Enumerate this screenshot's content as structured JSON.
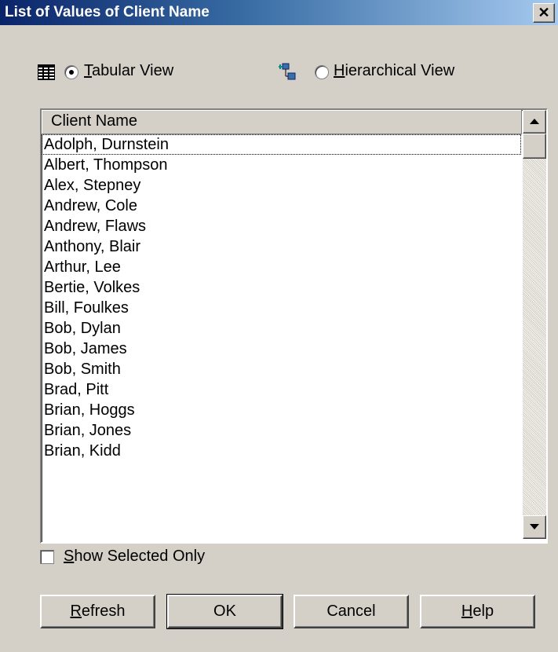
{
  "window": {
    "title": "List of Values of Client Name",
    "close_label": "✕"
  },
  "view": {
    "tabular": {
      "mnemonic": "T",
      "rest": "abular View",
      "selected": true
    },
    "hierarchical": {
      "mnemonic": "H",
      "rest": "ierarchical View",
      "selected": false
    }
  },
  "list": {
    "column_header": "Client Name",
    "rows": [
      "Adolph, Durnstein",
      "Albert, Thompson",
      "Alex, Stepney",
      "Andrew, Cole",
      "Andrew, Flaws",
      "Anthony, Blair",
      "Arthur, Lee",
      "Bertie, Volkes",
      "Bill, Foulkes",
      "Bob, Dylan",
      "Bob, James",
      "Bob, Smith",
      "Brad, Pitt",
      "Brian, Hoggs",
      "Brian, Jones",
      "Brian, Kidd"
    ]
  },
  "show_selected": {
    "mnemonic": "S",
    "rest": "how Selected Only",
    "checked": false
  },
  "buttons": {
    "refresh": {
      "mnemonic": "R",
      "rest": "efresh"
    },
    "ok": "OK",
    "cancel": "Cancel",
    "help": {
      "mnemonic": "H",
      "rest": "elp"
    }
  }
}
